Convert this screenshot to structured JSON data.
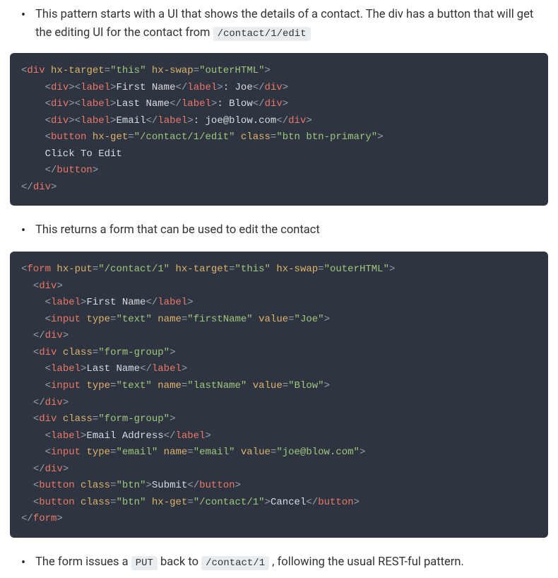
{
  "bullets": {
    "b1_pre": "This pattern starts with a UI that shows the details of a contact. The div has a button that will get the editing UI for the contact from ",
    "b1_code": "/contact/1/edit",
    "b2": "This returns a form that can be used to edit the contact",
    "b3_pre": "The form issues a ",
    "b3_code1": "PUT",
    "b3_mid": " back to ",
    "b3_code2": "/contact/1",
    "b3_post": " , following the usual REST-ful pattern."
  },
  "code1": {
    "div": "div",
    "hx_target_attr": "hx-target",
    "hx_target_val": "\"this\"",
    "hx_swap_attr": "hx-swap",
    "hx_swap_val": "\"outerHTML\"",
    "label": "label",
    "fn_label": "First Name",
    "fn_val": ": Joe",
    "ln_label": "Last Name",
    "ln_val": ": Blow",
    "em_label": "Email",
    "em_val": ": joe@blow.com",
    "button": "button",
    "hx_get_attr": "hx-get",
    "hx_get_val": "\"/contact/1/edit\"",
    "class_attr": "class",
    "class_val": "\"btn btn-primary\"",
    "btn_text": "    Click To Edit"
  },
  "code2": {
    "form": "form",
    "hx_put_attr": "hx-put",
    "hx_put_val": "\"/contact/1\"",
    "hx_target_attr": "hx-target",
    "hx_target_val": "\"this\"",
    "hx_swap_attr": "hx-swap",
    "hx_swap_val": "\"outerHTML\"",
    "div": "div",
    "label": "label",
    "fn_label": "First Name",
    "input": "input",
    "type_attr": "type",
    "type_text": "\"text\"",
    "type_email": "\"email\"",
    "name_attr": "name",
    "name_fn": "\"firstName\"",
    "name_ln": "\"lastName\"",
    "name_em": "\"email\"",
    "value_attr": "value",
    "value_fn": "\"Joe\"",
    "value_ln": "\"Blow\"",
    "value_em": "\"joe@blow.com\"",
    "class_attr": "class",
    "class_fg": "\"form-group\"",
    "class_btn": "\"btn\"",
    "ln_label": "Last Name",
    "em_label": "Email Address",
    "button": "button",
    "submit_text": "Submit",
    "cancel_text": "Cancel",
    "hx_get_attr": "hx-get",
    "hx_get_val": "\"/contact/1\""
  }
}
